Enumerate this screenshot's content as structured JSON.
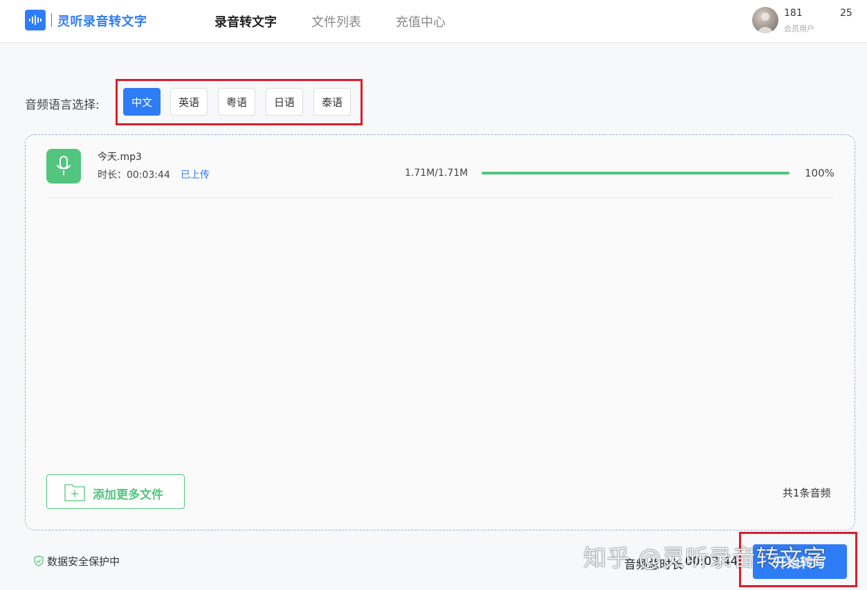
{
  "header": {
    "app_name": "灵听录音转文字",
    "nav": [
      {
        "label": "录音转文字",
        "active": true
      },
      {
        "label": "文件列表",
        "active": false
      },
      {
        "label": "充值中心",
        "active": false
      }
    ],
    "user": {
      "name_start": "181",
      "name_end": "25",
      "role": "会员用户"
    }
  },
  "language": {
    "label": "音频语言选择:",
    "options": [
      "中文",
      "英语",
      "粤语",
      "日语",
      "泰语"
    ],
    "selected": "中文"
  },
  "file": {
    "name": "今天.mp3",
    "duration": "时长：00:03:44",
    "status": "已上传",
    "size": "1.71M/1.71M",
    "progress_label": "100%",
    "progress": 1.0
  },
  "add_files_label": "添加更多文件",
  "count_label": "共1条音频",
  "security_label": "数据安全保护中",
  "total": {
    "label": "音频总时长",
    "value": "00:03:44"
  },
  "start_button_label": "开始转写",
  "watermark": "知乎 @灵听录音转文字",
  "colors": {
    "accent": "#2e7cf6",
    "success": "#52c57e",
    "highlight": "#d91e2b"
  }
}
